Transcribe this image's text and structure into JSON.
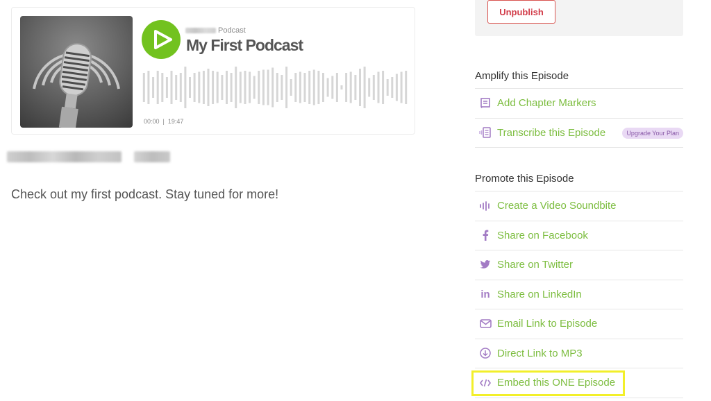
{
  "player": {
    "show_label": "Podcast",
    "episode_title": "My First Podcast",
    "current_time": "00:00",
    "separator": "|",
    "duration": "19:47",
    "play_color": "#72c21f",
    "waveform_color": "#d6d6d6"
  },
  "episode": {
    "description": "Check out my first podcast. Stay tuned for more!"
  },
  "publish": {
    "unpublish_label": "Unpublish"
  },
  "amplify": {
    "title": "Amplify this Episode",
    "items": [
      {
        "label": "Add Chapter Markers",
        "icon": "chapter-markers-icon"
      },
      {
        "label": "Transcribe this Episode",
        "icon": "transcribe-icon",
        "badge": "Upgrade Your Plan"
      }
    ]
  },
  "promote": {
    "title": "Promote this Episode",
    "items": [
      {
        "label": "Create a Video Soundbite",
        "icon": "soundbite-icon"
      },
      {
        "label": "Share on Facebook",
        "icon": "facebook-icon"
      },
      {
        "label": "Share on Twitter",
        "icon": "twitter-icon"
      },
      {
        "label": "Share on LinkedIn",
        "icon": "linkedin-icon"
      },
      {
        "label": "Email Link to Episode",
        "icon": "email-icon"
      },
      {
        "label": "Direct Link to MP3",
        "icon": "download-icon"
      },
      {
        "label": "Embed this ONE Episode",
        "icon": "embed-code-icon",
        "highlighted": true
      }
    ]
  },
  "colors": {
    "link_green": "#7cbd3f",
    "icon_purple": "#a27bc4",
    "unpublish_red": "#d23d4a",
    "highlight_yellow": "#f2ef2a",
    "badge_bg": "#e9d9f4"
  }
}
